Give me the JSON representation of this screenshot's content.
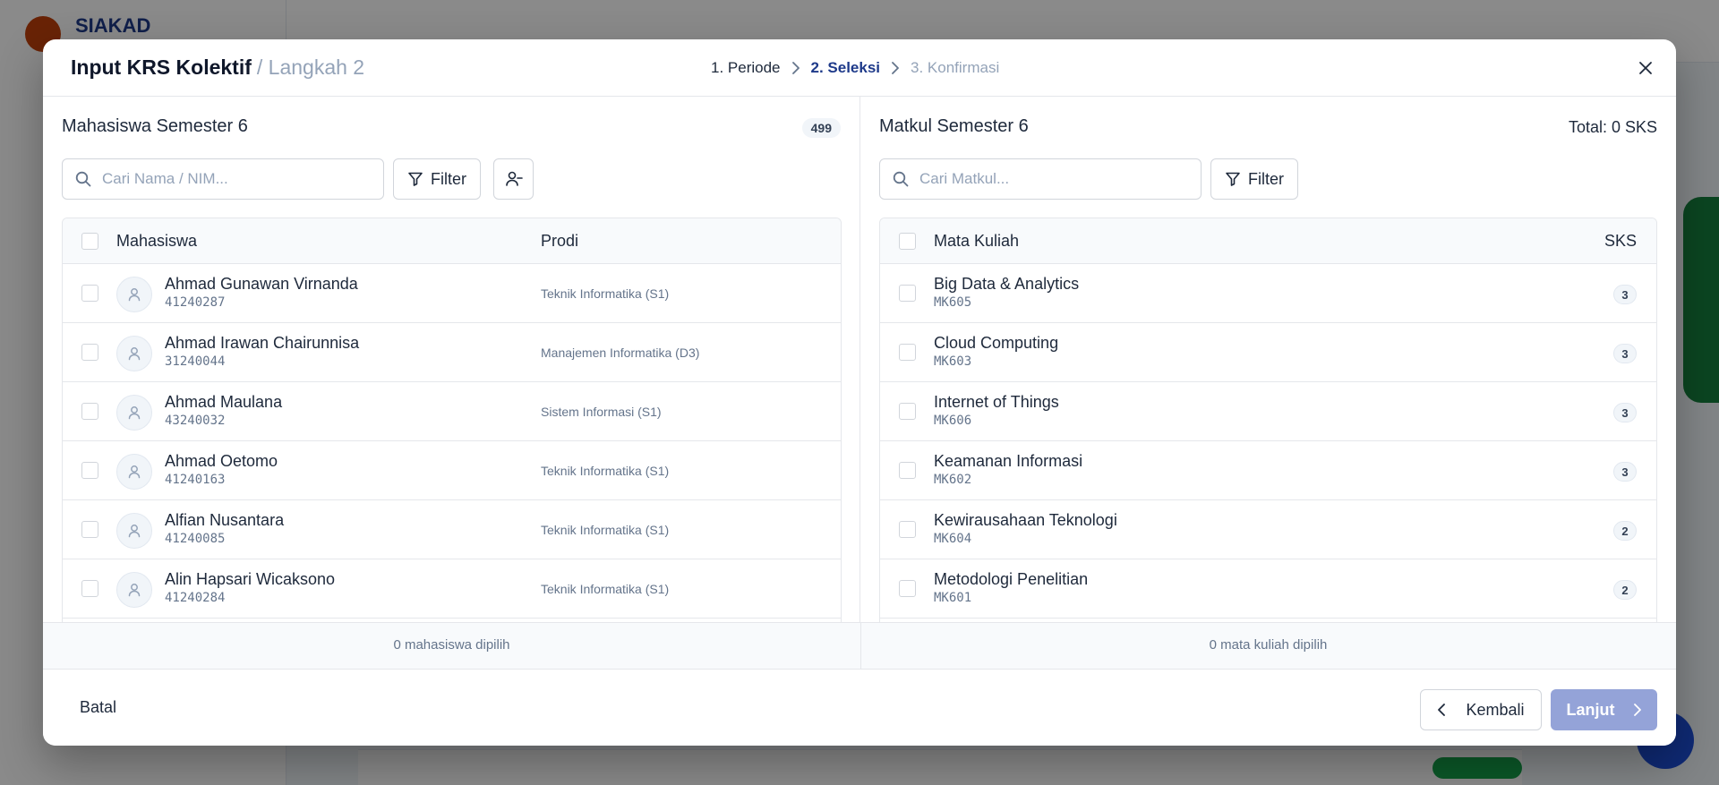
{
  "background": {
    "brand": "SIAKAD"
  },
  "modal": {
    "title": "Input KRS Kolektif",
    "subtitle": "/ Langkah 2",
    "steps": [
      {
        "label": "1. Periode",
        "state": "done"
      },
      {
        "label": "2. Seleksi",
        "state": "active"
      },
      {
        "label": "3. Konfirmasi",
        "state": "todo"
      }
    ],
    "close_icon": "close-icon"
  },
  "students_panel": {
    "title": "Mahasiswa Semester 6",
    "count": "499",
    "search_placeholder": "Cari Nama / NIM...",
    "filter_label": "Filter",
    "columns": {
      "name": "Mahasiswa",
      "prodi": "Prodi"
    },
    "rows": [
      {
        "name": "Ahmad Gunawan Virnanda",
        "nim": "41240287",
        "prodi": "Teknik Informatika (S1)"
      },
      {
        "name": "Ahmad Irawan Chairunnisa",
        "nim": "31240044",
        "prodi": "Manajemen Informatika (D3)"
      },
      {
        "name": "Ahmad Maulana",
        "nim": "43240032",
        "prodi": "Sistem Informasi (S1)"
      },
      {
        "name": "Ahmad Oetomo",
        "nim": "41240163",
        "prodi": "Teknik Informatika (S1)"
      },
      {
        "name": "Alfian Nusantara",
        "nim": "41240085",
        "prodi": "Teknik Informatika (S1)"
      },
      {
        "name": "Alin Hapsari Wicaksono",
        "nim": "41240284",
        "prodi": "Teknik Informatika (S1)"
      }
    ],
    "selected_text": "0 mahasiswa dipilih"
  },
  "courses_panel": {
    "title": "Matkul Semester 6",
    "total": "Total: 0 SKS",
    "search_placeholder": "Cari Matkul...",
    "filter_label": "Filter",
    "columns": {
      "name": "Mata Kuliah",
      "sks": "SKS"
    },
    "rows": [
      {
        "name": "Big Data & Analytics",
        "code": "MK605",
        "sks": "3"
      },
      {
        "name": "Cloud Computing",
        "code": "MK603",
        "sks": "3"
      },
      {
        "name": "Internet of Things",
        "code": "MK606",
        "sks": "3"
      },
      {
        "name": "Keamanan Informasi",
        "code": "MK602",
        "sks": "3"
      },
      {
        "name": "Kewirausahaan Teknologi",
        "code": "MK604",
        "sks": "2"
      },
      {
        "name": "Metodologi Penelitian",
        "code": "MK601",
        "sks": "2"
      }
    ],
    "selected_text": "0 mata kuliah dipilih"
  },
  "footer": {
    "cancel_label": "Batal",
    "back_label": "Kembali",
    "next_label": "Lanjut"
  },
  "colors": {
    "accent": "#1e3a8a",
    "next_disabled": "#94a3d8"
  }
}
